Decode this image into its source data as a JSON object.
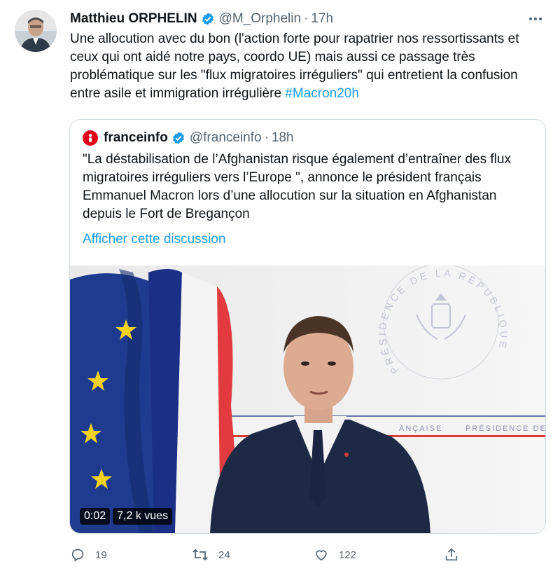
{
  "tweet": {
    "author_name": "Matthieu ORPHELIN",
    "handle": "@M_Orphelin",
    "separator": "·",
    "time": "17h",
    "text_main": "Une allocution avec du bon (l'action forte pour rapatrier nos ressortissants et ceux qui ont aidé notre pays, coordo UE) mais aussi ce passage très problématique sur les \"flux migratoires irréguliers\" qui entretient la confusion entre asile et immigration irrégulière ",
    "hashtag": "#Macron20h"
  },
  "quote": {
    "author_name": "franceinfo",
    "handle": "@franceinfo",
    "separator": "·",
    "time": "18h",
    "text": "\"La déstabilisation de l’Afghanistan risque également d’entraîner des flux migratoires irréguliers vers l’Europe \", annonce le président français Emmanuel Macron lors d’une allocution sur la situation en Afghanistan depuis le Fort de Bregançon",
    "show_thread_label": "Afficher cette discussion",
    "video": {
      "elapsed": "0:02",
      "views": "7,2 k vues",
      "seal_text": "PRÉSIDENCE DE LA RÉPUBLIQUE",
      "banner_left": "ANÇAISE",
      "banner_right": "PRÉSIDENCE DE"
    }
  },
  "actions": {
    "reply_count": "19",
    "retweet_count": "24",
    "like_count": "122"
  },
  "colors": {
    "accent": "#1d9bf0",
    "verified": "#1d9bf0",
    "franceinfo_red": "#e3001b",
    "secondary_text": "#536471"
  },
  "icons": [
    "verified-badge-icon",
    "more-options-icon",
    "reply-icon",
    "retweet-icon",
    "like-icon",
    "share-icon"
  ]
}
